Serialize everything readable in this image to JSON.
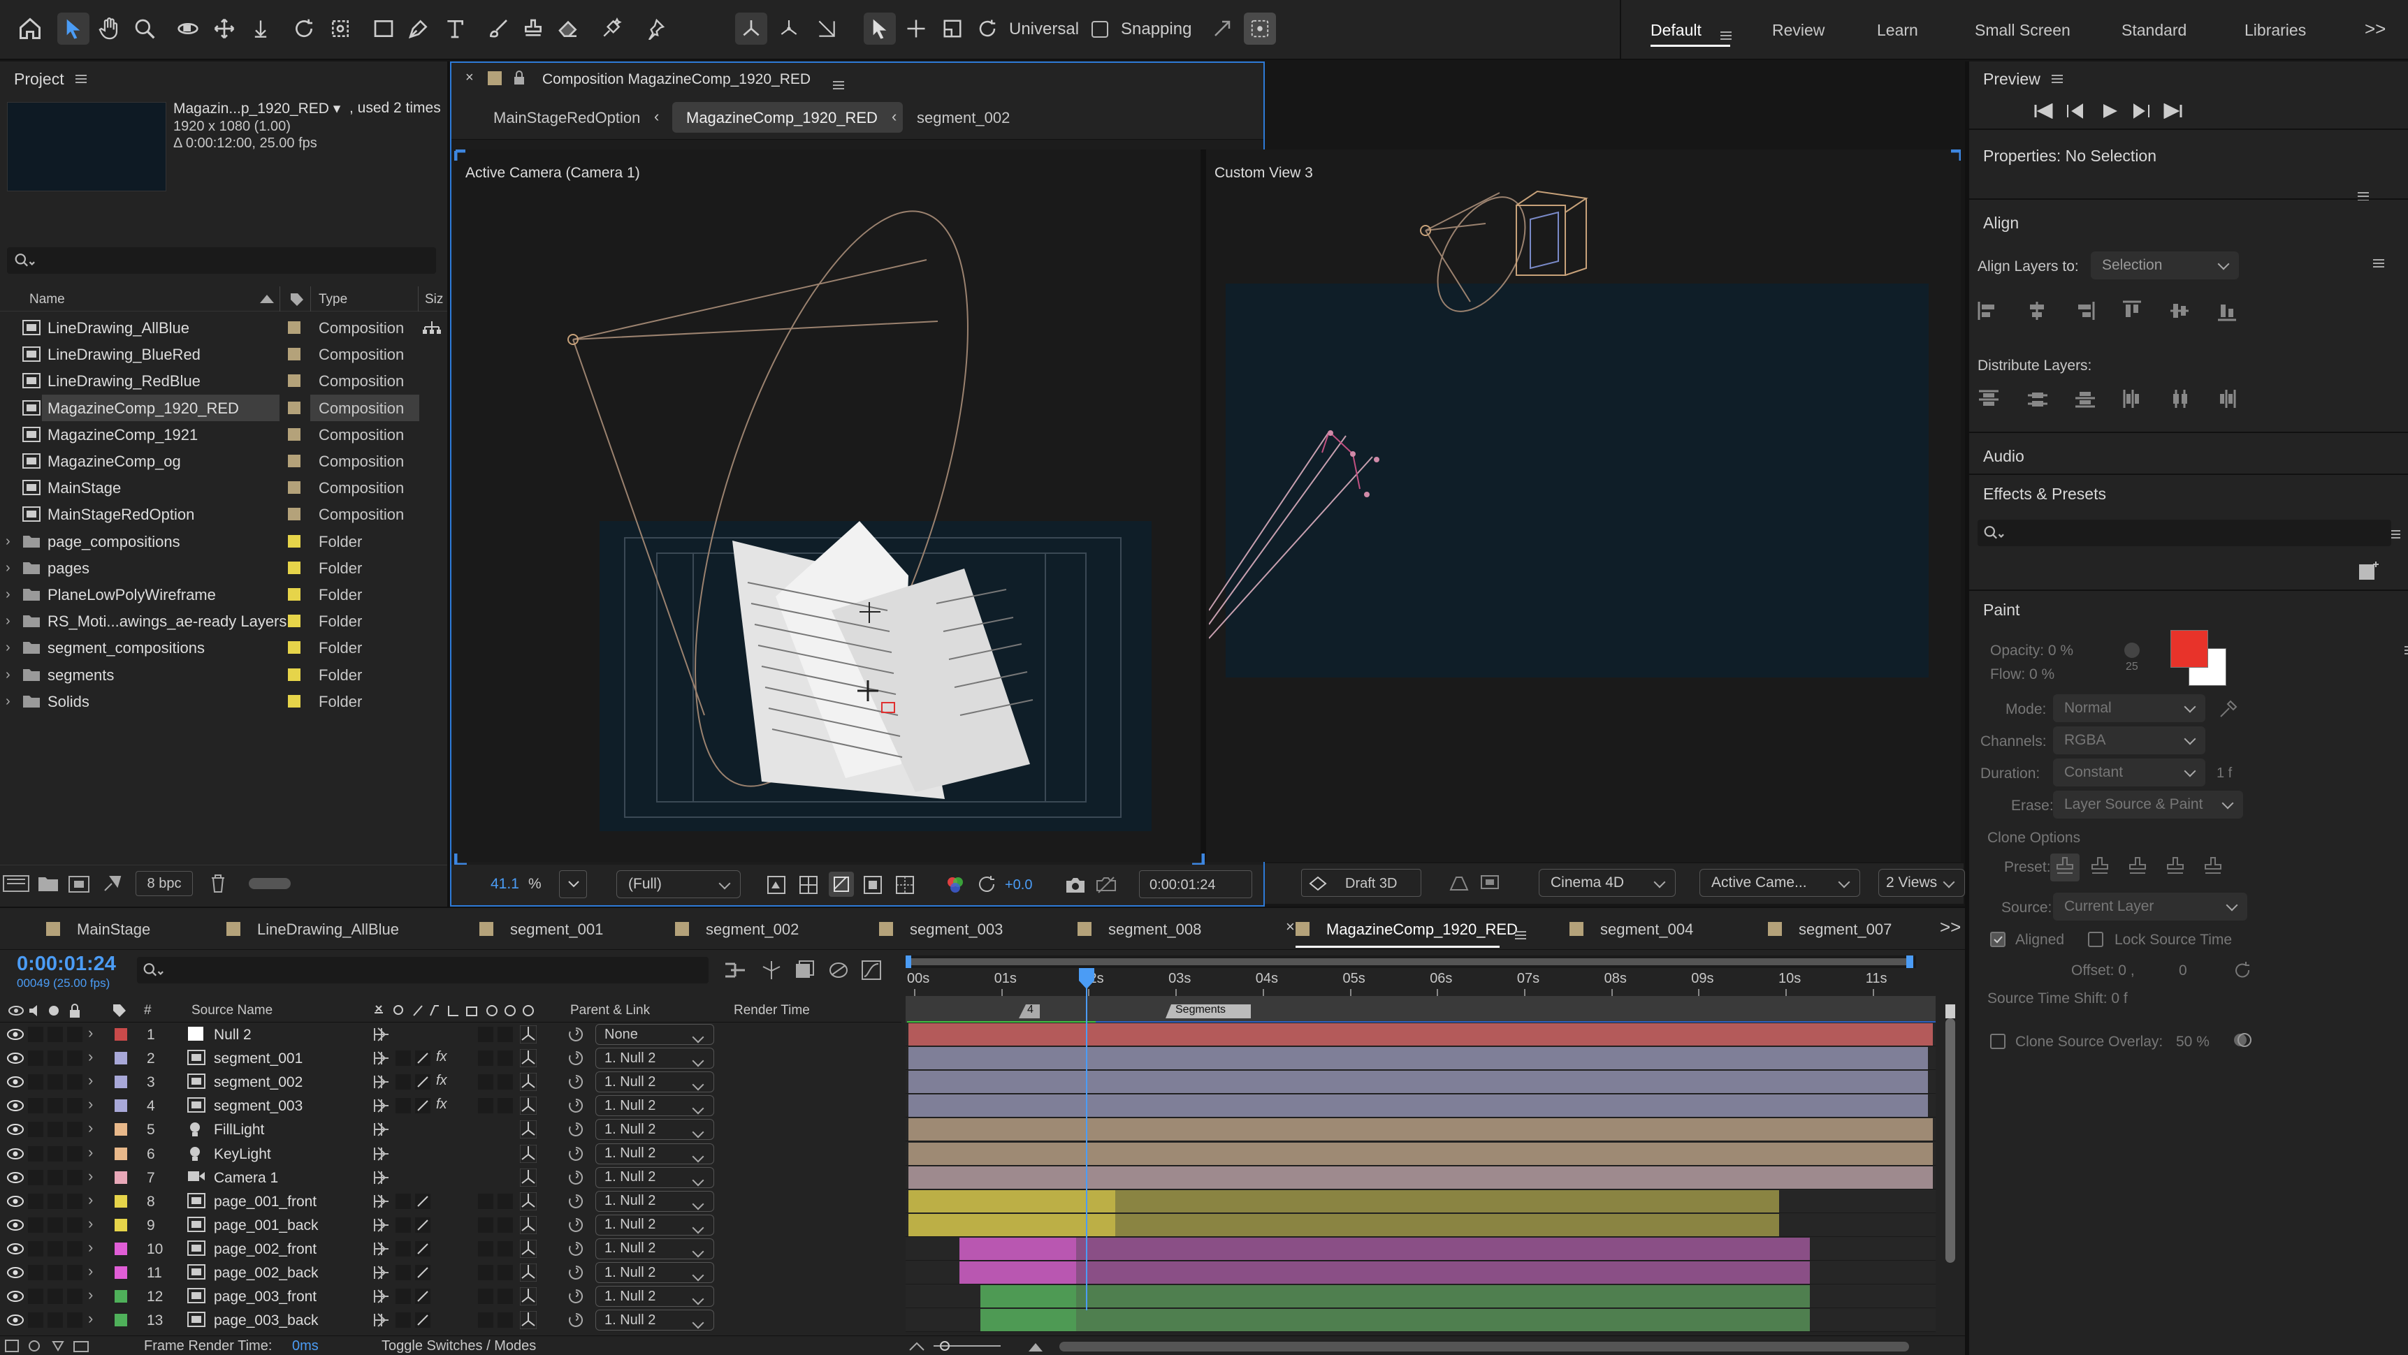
{
  "toolbar": {
    "universal": "Universal",
    "snapping": "Snapping",
    "workspaces": [
      "Default",
      "Review",
      "Learn",
      "Small Screen",
      "Standard",
      "Libraries"
    ],
    "more": ">>"
  },
  "project": {
    "title": "Project",
    "footage_name": "Magazin...p_1920_RED ▾",
    "used": ", used 2 times",
    "dims": "1920 x 1080 (1.00)",
    "duration": "Δ 0:00:12:00, 25.00 fps",
    "search_placeholder": "",
    "col_name": "Name",
    "col_type": "Type",
    "col_size": "Siz",
    "bpc": "8 bpc",
    "items": [
      {
        "name": "LineDrawing_AllBlue",
        "type": "Composition",
        "kind": "comp",
        "label": "#b4a27a"
      },
      {
        "name": "LineDrawing_BlueRed",
        "type": "Composition",
        "kind": "comp",
        "label": "#b4a27a"
      },
      {
        "name": "LineDrawing_RedBlue",
        "type": "Composition",
        "kind": "comp",
        "label": "#b4a27a"
      },
      {
        "name": "MagazineComp_1920_RED",
        "type": "Composition",
        "kind": "comp",
        "label": "#b4a27a"
      },
      {
        "name": "MagazineComp_1921",
        "type": "Composition",
        "kind": "comp",
        "label": "#b4a27a"
      },
      {
        "name": "MagazineComp_og",
        "type": "Composition",
        "kind": "comp",
        "label": "#b4a27a"
      },
      {
        "name": "MainStage",
        "type": "Composition",
        "kind": "comp",
        "label": "#b4a27a"
      },
      {
        "name": "MainStageRedOption",
        "type": "Composition",
        "kind": "comp",
        "label": "#b4a27a"
      },
      {
        "name": "page_compositions",
        "type": "Folder",
        "kind": "folder",
        "label": "#e6d44a"
      },
      {
        "name": "pages",
        "type": "Folder",
        "kind": "folder",
        "label": "#e6d44a"
      },
      {
        "name": "PlaneLowPolyWireframe",
        "type": "Folder",
        "kind": "folder",
        "label": "#e6d44a"
      },
      {
        "name": "RS_Moti...awings_ae-ready Layers",
        "type": "Folder",
        "kind": "folder",
        "label": "#e6d44a"
      },
      {
        "name": "segment_compositions",
        "type": "Folder",
        "kind": "folder",
        "label": "#e6d44a"
      },
      {
        "name": "segments",
        "type": "Folder",
        "kind": "folder",
        "label": "#e6d44a"
      },
      {
        "name": "Solids",
        "type": "Folder",
        "kind": "folder",
        "label": "#e6d44a"
      }
    ]
  },
  "composition": {
    "title": "Composition MagazineComp_1920_RED",
    "breadcrumbs": [
      "MainStageRedOption",
      "MagazineComp_1920_RED",
      "segment_002"
    ],
    "view_left": "Active Camera (Camera 1)",
    "view_right": "Custom View 3",
    "footer": {
      "zoom": "41.1",
      "pct": "%",
      "resolution": "(Full)",
      "exposure": "+0.0",
      "timecode": "0:00:01:24",
      "draft": "Draft 3D",
      "renderer": "Cinema 4D",
      "camera": "Active Came...",
      "views": "2 Views"
    }
  },
  "right": {
    "preview": "Preview",
    "properties": "Properties: No Selection",
    "align": "Align",
    "align_to_label": "Align Layers to:",
    "align_to": "Selection",
    "distribute": "Distribute Layers:",
    "audio": "Audio",
    "effects": "Effects & Presets",
    "paint": "Paint",
    "opacity": "Opacity: 0 %",
    "flow": "Flow: 0 %",
    "flow_val": "25",
    "mode_label": "Mode:",
    "mode": "Normal",
    "channels_label": "Channels:",
    "channels": "RGBA",
    "duration_label": "Duration:",
    "duration": "Constant",
    "duration_val": "1 f",
    "erase_label": "Erase:",
    "erase": "Layer Source & Paint",
    "clone_options": "Clone Options",
    "preset_label": "Preset:",
    "source_label": "Source:",
    "source": "Current Layer",
    "aligned": "Aligned",
    "lock_source": "Lock Source Time",
    "offset": "Offset: 0 ,",
    "offset_y": "0",
    "shift": "Source Time Shift: 0 f",
    "overlay": "Clone Source Overlay:",
    "overlay_val": "50 %",
    "fg_color": "#e8332a",
    "bg_color": "#ffffff"
  },
  "timeline": {
    "tabs": [
      {
        "name": "MainStage",
        "active": false
      },
      {
        "name": "LineDrawing_AllBlue",
        "active": false
      },
      {
        "name": "segment_001",
        "active": false
      },
      {
        "name": "segment_002",
        "active": false
      },
      {
        "name": "segment_003",
        "active": false
      },
      {
        "name": "segment_008",
        "active": false
      },
      {
        "name": "MagazineComp_1920_RED",
        "active": true
      },
      {
        "name": "segment_004",
        "active": false
      },
      {
        "name": "segment_007",
        "active": false
      }
    ],
    "timecode": "0:00:01:24",
    "frame": "00049 (25.00 fps)",
    "col_source": "Source Name",
    "col_parent": "Parent & Link",
    "col_render": "Render Time",
    "ruler": [
      "00s",
      "01s",
      "02s",
      "03s",
      "04s",
      "05s",
      "06s",
      "07s",
      "08s",
      "09s",
      "10s",
      "11s"
    ],
    "marker_4": "4",
    "marker_segments": "Segments",
    "footer_render": "Frame Render Time:",
    "footer_ms": "0ms",
    "footer_toggle": "Toggle Switches / Modes",
    "layers": [
      {
        "num": "1",
        "name": "Null 2",
        "label": "#c94a4a",
        "icon": "null",
        "parent": "None",
        "fx": false,
        "bar": "#b45a5a",
        "barStart": 0,
        "barEnd": 1
      },
      {
        "num": "2",
        "name": "segment_001",
        "label": "#a8a8d8",
        "icon": "comp",
        "parent": "1. Null 2",
        "fx": true,
        "bar": "#7f7f98",
        "barStart": 0,
        "barEnd": 0.995
      },
      {
        "num": "3",
        "name": "segment_002",
        "label": "#a8a8d8",
        "icon": "comp",
        "parent": "1. Null 2",
        "fx": true,
        "bar": "#7f7f98",
        "barStart": 0,
        "barEnd": 0.995
      },
      {
        "num": "4",
        "name": "segment_003",
        "label": "#a8a8d8",
        "icon": "comp",
        "parent": "1. Null 2",
        "fx": true,
        "bar": "#7f7f98",
        "barStart": 0,
        "barEnd": 0.995
      },
      {
        "num": "5",
        "name": "FillLight",
        "label": "#e8b88a",
        "icon": "light",
        "parent": "1. Null 2",
        "fx": false,
        "bar": "#9e8a74",
        "barStart": 0,
        "barEnd": 1
      },
      {
        "num": "6",
        "name": "KeyLight",
        "label": "#e8b88a",
        "icon": "light",
        "parent": "1. Null 2",
        "fx": false,
        "bar": "#9e8a74",
        "barStart": 0,
        "barEnd": 1
      },
      {
        "num": "7",
        "name": "Camera 1",
        "label": "#e8a8b8",
        "icon": "camera",
        "parent": "1. Null 2",
        "fx": false,
        "bar": "#9e8a8e",
        "barStart": 0,
        "barEnd": 1
      },
      {
        "num": "8",
        "name": "page_001_front",
        "label": "#e6d44a",
        "icon": "comp",
        "parent": "1. Null 2",
        "fx": false,
        "bar": "#8a8442",
        "barStart": 0,
        "barEnd": 0.85
      },
      {
        "num": "9",
        "name": "page_001_back",
        "label": "#e6d44a",
        "icon": "comp",
        "parent": "1. Null 2",
        "fx": false,
        "bar": "#8a8442",
        "barStart": 0,
        "barEnd": 0.85
      },
      {
        "num": "10",
        "name": "page_002_front",
        "label": "#e05ed6",
        "icon": "comp",
        "parent": "1. Null 2",
        "fx": false,
        "bar": "#8a4f86",
        "barStart": 0.05,
        "barEnd": 0.88
      },
      {
        "num": "11",
        "name": "page_002_back",
        "label": "#e05ed6",
        "icon": "comp",
        "parent": "1. Null 2",
        "fx": false,
        "bar": "#8a4f86",
        "barStart": 0.05,
        "barEnd": 0.88
      },
      {
        "num": "12",
        "name": "page_003_front",
        "label": "#4fb05a",
        "icon": "comp",
        "parent": "1. Null 2",
        "fx": false,
        "bar": "#4f7f4f",
        "barStart": 0.07,
        "barEnd": 0.88
      },
      {
        "num": "13",
        "name": "page_003_back",
        "label": "#4fb05a",
        "icon": "comp",
        "parent": "1. Null 2",
        "fx": false,
        "bar": "#4f7f4f",
        "barStart": 0.07,
        "barEnd": 0.88
      }
    ]
  }
}
